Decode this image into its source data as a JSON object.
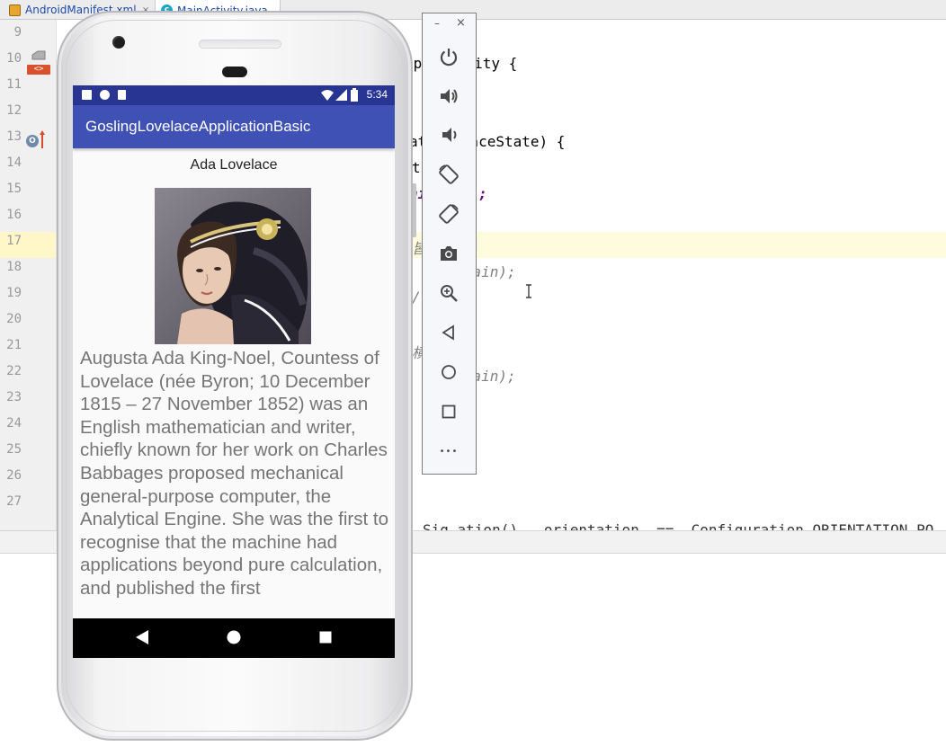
{
  "ide": {
    "tabs": [
      {
        "label": "AndroidManifest.xml",
        "icon": "xml-file-icon"
      },
      {
        "label": "MainActivity.java",
        "icon": "java-class-icon"
      }
    ],
    "line_numbers": [
      "9",
      "10",
      "11",
      "12",
      "13",
      "14",
      "15",
      "16",
      "17",
      "18",
      "19",
      "20",
      "21",
      "22",
      "23",
      "24",
      "25",
      "26",
      "27"
    ],
    "code_fragments": {
      "line10": "pp Activity {",
      "line13": "at   tanceState) {",
      "line14": "t",
      "line15": "ni   in);",
      "line17": "皆",
      "line18": "   ty_main);",
      "line19": "/",
      "line21": "横",
      "line22": "   ty_main);",
      "line28": "Sig_ation()   orientation  ==  Configuration.ORIENTATION_PO"
    },
    "gutter_marker_label": "<>",
    "gutter_override_label": "O"
  },
  "phone": {
    "status_time": "5:34",
    "app_title": "GoslingLovelaceApplicationBasic",
    "content_title": "Ada Lovelace",
    "bio_text": "Augusta Ada King-Noel, Countess of Lovelace (née Byron; 10 December 1815 – 27 November 1852) was an English mathematician and writer, chiefly known for her work on Charles Babbages proposed mechanical general-purpose computer, the Analytical Engine. She was the first to recognise that the machine had applications beyond pure calculation, and published the first",
    "colors": {
      "status_bar": "#283593",
      "app_bar": "#3f51b5",
      "nav_bar": "#000000"
    }
  },
  "emulator_toolbar": {
    "minimize_label": "–",
    "close_label": "×",
    "buttons": [
      "power-icon",
      "volume-up-icon",
      "volume-down-icon",
      "rotate-left-icon",
      "rotate-right-icon",
      "camera-icon",
      "zoom-icon",
      "back-icon",
      "home-icon",
      "overview-icon",
      "more-icon"
    ],
    "more_label": "•••"
  }
}
